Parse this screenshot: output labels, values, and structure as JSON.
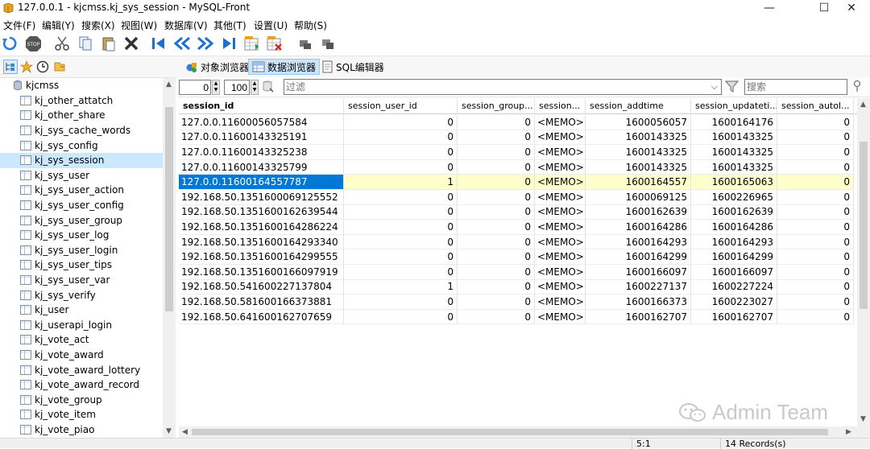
{
  "window": {
    "title": "127.0.0.1 - kjcmss.kj_sys_session - MySQL-Front",
    "minimize_glyph": "—",
    "maximize_glyph": "☐",
    "close_glyph": "✕"
  },
  "menu": [
    "文件(F)",
    "编辑(Y)",
    "搜索(X)",
    "视图(W)",
    "数据库(V)",
    "其他(T)",
    "设置(U)",
    "帮助(S)"
  ],
  "toolbar": {
    "icons": [
      "refresh-icon",
      "stop-icon",
      "cut-icon",
      "copy-icon",
      "paste-icon",
      "delete-icon",
      "first-record-icon",
      "previous-page-icon",
      "next-page-icon",
      "last-record-icon",
      "insert-record-icon",
      "delete-record-icon",
      "post-icon",
      "cancel-icon"
    ]
  },
  "sidebar_toolbar": {
    "icons": [
      "tree-view-icon",
      "favorites-icon",
      "history-icon",
      "files-icon"
    ]
  },
  "tabs": [
    {
      "label": "对象浏览器",
      "icon": "object-browser-icon",
      "active": false
    },
    {
      "label": "数据浏览器",
      "icon": "data-browser-icon",
      "active": true
    },
    {
      "label": "SQL编辑器",
      "icon": "sql-editor-icon",
      "active": false
    }
  ],
  "filter_bar": {
    "offset": "0",
    "limit": "100",
    "filter_placeholder": "过滤",
    "search_placeholder": "搜索"
  },
  "sidebar": {
    "database": "kjcmss",
    "tables": [
      "kj_other_attatch",
      "kj_other_share",
      "kj_sys_cache_words",
      "kj_sys_config",
      "kj_sys_session",
      "kj_sys_user",
      "kj_sys_user_action",
      "kj_sys_user_config",
      "kj_sys_user_group",
      "kj_sys_user_log",
      "kj_sys_user_login",
      "kj_sys_user_tips",
      "kj_sys_user_var",
      "kj_sys_verify",
      "kj_user",
      "kj_userapi_login",
      "kj_vote_act",
      "kj_vote_award",
      "kj_vote_award_lottery",
      "kj_vote_award_record",
      "kj_vote_group",
      "kj_vote_item",
      "kj_vote_piao"
    ],
    "selected": "kj_sys_session"
  },
  "grid": {
    "columns": [
      "session_id",
      "session_user_id",
      "session_group...",
      "session...",
      "session_addtime",
      "session_updateti...",
      "session_autol...",
      "se"
    ],
    "rows": [
      [
        "127.0.0.11600056057584",
        "0",
        "0",
        "<MEMO>",
        "1600056057",
        "1600164176",
        "0"
      ],
      [
        "127.0.0.11600143325191",
        "0",
        "0",
        "<MEMO>",
        "1600143325",
        "1600143325",
        "0"
      ],
      [
        "127.0.0.11600143325238",
        "0",
        "0",
        "<MEMO>",
        "1600143325",
        "1600143325",
        "0"
      ],
      [
        "127.0.0.11600143325799",
        "0",
        "0",
        "<MEMO>",
        "1600143325",
        "1600143325",
        "0"
      ],
      [
        "127.0.0.11600164557787",
        "1",
        "0",
        "<MEMO>",
        "1600164557",
        "1600165063",
        "0"
      ],
      [
        "192.168.50.1351600069125552",
        "0",
        "0",
        "<MEMO>",
        "1600069125",
        "1600226965",
        "0"
      ],
      [
        "192.168.50.1351600162639544",
        "0",
        "0",
        "<MEMO>",
        "1600162639",
        "1600162639",
        "0"
      ],
      [
        "192.168.50.1351600164286224",
        "0",
        "0",
        "<MEMO>",
        "1600164286",
        "1600164286",
        "0"
      ],
      [
        "192.168.50.1351600164293340",
        "0",
        "0",
        "<MEMO>",
        "1600164293",
        "1600164293",
        "0"
      ],
      [
        "192.168.50.1351600164299555",
        "0",
        "0",
        "<MEMO>",
        "1600164299",
        "1600164299",
        "0"
      ],
      [
        "192.168.50.1351600166097919",
        "0",
        "0",
        "<MEMO>",
        "1600166097",
        "1600166097",
        "0"
      ],
      [
        "192.168.50.541600227137804",
        "1",
        "0",
        "<MEMO>",
        "1600227137",
        "1600227224",
        "0"
      ],
      [
        "192.168.50.581600166373881",
        "0",
        "0",
        "<MEMO>",
        "1600166373",
        "1600223027",
        "0"
      ],
      [
        "192.168.50.641600162707659",
        "0",
        "0",
        "<MEMO>",
        "1600162707",
        "1600162707",
        "0"
      ]
    ],
    "selected_row": 4
  },
  "status": {
    "position": "5:1",
    "records": "14 Records(s)"
  },
  "watermark": "Admin Team",
  "colors": {
    "selected_cell": "#0078d7",
    "selected_row": "#ffffcc",
    "tree_selected": "#cce8ff"
  }
}
